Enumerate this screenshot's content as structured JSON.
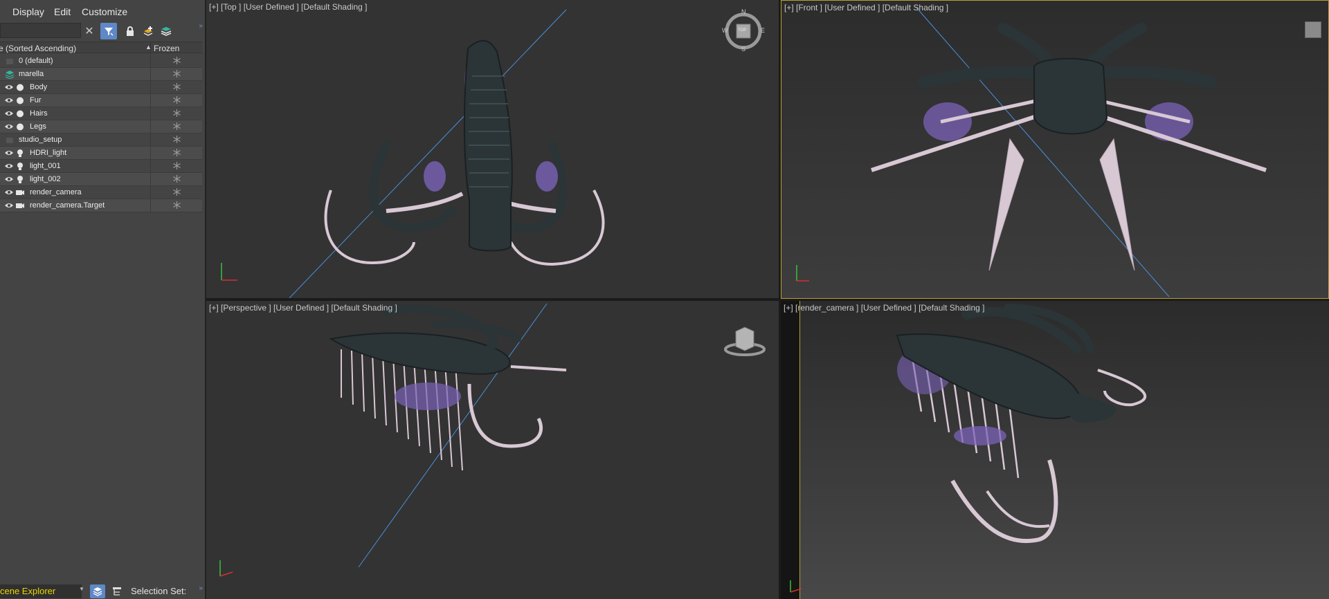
{
  "menu": {
    "display": "Display",
    "edit": "Edit",
    "customize": "Customize"
  },
  "toolbar": {
    "search_placeholder": "",
    "clear_icon": "close-icon",
    "dock": "»"
  },
  "list": {
    "col_name": "e (Sorted Ascending)",
    "col_frozen": "Frozen",
    "sort_arrow": "▲",
    "rows": [
      {
        "label": "0 (default)",
        "type": "layer"
      },
      {
        "label": "marella",
        "type": "layer-active"
      },
      {
        "label": "Body",
        "type": "geometry"
      },
      {
        "label": "Fur",
        "type": "geometry"
      },
      {
        "label": "Hairs",
        "type": "geometry"
      },
      {
        "label": "Legs",
        "type": "geometry"
      },
      {
        "label": "studio_setup",
        "type": "layer"
      },
      {
        "label": "HDRI_light",
        "type": "light"
      },
      {
        "label": "light_001",
        "type": "light"
      },
      {
        "label": "light_002",
        "type": "light"
      },
      {
        "label": "render_camera",
        "type": "camera"
      },
      {
        "label": "render_camera.Target",
        "type": "camera"
      }
    ]
  },
  "bottom": {
    "explorer_tab": "cene Explorer",
    "selection_set": "Selection Set:",
    "dock": "»"
  },
  "viewports": {
    "top": {
      "label": "[+] [Top ] [User Defined ] [Default Shading ]",
      "compass": {
        "n": "N",
        "s": "S",
        "e": "E",
        "w": "W",
        "cube": "TOP"
      }
    },
    "front": {
      "label": "[+] [Front ] [User Defined ] [Default Shading ]"
    },
    "persp": {
      "label": "[+] [Perspective ] [User Defined ] [Default Shading ]"
    },
    "camera": {
      "label": "[+] [render_camera ] [User Defined ] [Default Shading ]"
    }
  },
  "colors": {
    "panel": "#444444",
    "viewport": "#333333",
    "active_border": "#b8a032",
    "selection_blue": "#5f88c6",
    "body": "#2b3436",
    "legs": "#d8c8d4",
    "fur": "#7b62b8",
    "helper_line": "#4a90d9"
  }
}
